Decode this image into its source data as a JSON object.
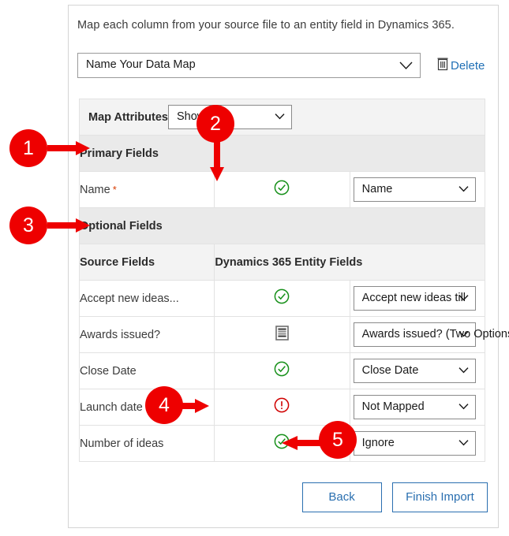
{
  "intro": {
    "text": "Map each column from your source file to an entity field in Dynamics 365."
  },
  "datamap": {
    "selected": "Name Your Data Map",
    "delete_label": "Delete",
    "delete_icon": "trash-icon",
    "chevron_icon": "chevron-down-icon"
  },
  "table": {
    "map_attributes_label": "Map Attributes",
    "show_filter": {
      "selected": "Show All",
      "chevron_icon": "chevron-down-icon"
    },
    "sections": {
      "primary": "Primary Fields",
      "optional": "Optional Fields"
    },
    "column_headers": {
      "source": "Source Fields",
      "target": "Dynamics 365 Entity Fields"
    },
    "primary_rows": [
      {
        "source": "Name",
        "required": true,
        "required_marker": "*",
        "status_icon": "check-circle-icon",
        "status": "mapped",
        "target": "Name"
      }
    ],
    "optional_rows": [
      {
        "source": "Accept new ideas...",
        "required": false,
        "status_icon": "check-circle-icon",
        "status": "mapped",
        "target": "Accept new ideas till"
      },
      {
        "source": "Awards issued?",
        "required": false,
        "status_icon": "option-set-list-icon",
        "status": "option-set",
        "target": "Awards issued? (Two Options)"
      },
      {
        "source": "Close Date",
        "required": false,
        "status_icon": "check-circle-icon",
        "status": "mapped",
        "target": "Close Date"
      },
      {
        "source": "Launch date",
        "required": false,
        "status_icon": "error-circle-icon",
        "status": "not-mapped",
        "target": "Not Mapped"
      },
      {
        "source": "Number of ideas",
        "required": false,
        "status_icon": "check-circle-icon",
        "status": "mapped",
        "target": "Ignore"
      }
    ]
  },
  "footer": {
    "back_label": "Back",
    "finish_label": "Finish Import"
  },
  "callouts": [
    {
      "number": "1",
      "points_to": "Primary Fields section header",
      "direction": "right"
    },
    {
      "number": "2",
      "points_to": "Name row status check icon",
      "direction": "down"
    },
    {
      "number": "3",
      "points_to": "Optional Fields section header",
      "direction": "right"
    },
    {
      "number": "4",
      "points_to": "Launch date error icon",
      "direction": "right"
    },
    {
      "number": "5",
      "points_to": "Ignore dropdown value",
      "direction": "left"
    }
  ],
  "colors": {
    "badge": "#EE0000",
    "link": "#1F6FB5",
    "button_border": "#2A6FB0",
    "success": "#1A8A1A",
    "error": "#D00000",
    "required": "#D83B01"
  }
}
